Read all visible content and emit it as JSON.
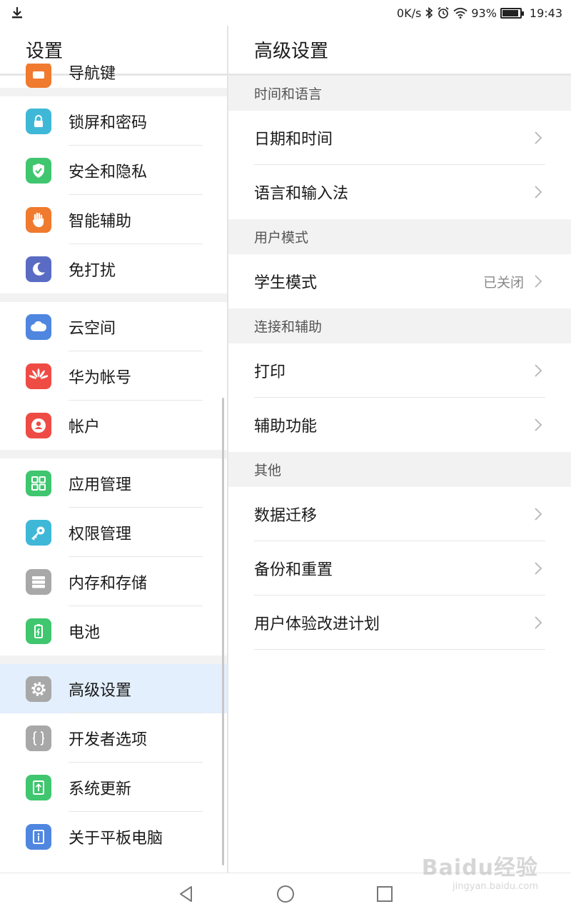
{
  "status_bar": {
    "net_speed": "0K/s",
    "battery_percent": "93%",
    "battery_level": 0.93,
    "time": "19:43"
  },
  "left_pane": {
    "title": "设置",
    "partial_item": {
      "label": "导航键",
      "icon": "nav-key-icon",
      "color": "#f07a2e"
    },
    "groups": [
      [
        {
          "label": "锁屏和密码",
          "icon": "lock-icon",
          "color": "#3fb8d8"
        },
        {
          "label": "安全和隐私",
          "icon": "shield-check-icon",
          "color": "#3fc66f"
        },
        {
          "label": "智能辅助",
          "icon": "hand-icon",
          "color": "#f07a2e"
        },
        {
          "label": "免打扰",
          "icon": "moon-icon",
          "color": "#5a6bc4"
        }
      ],
      [
        {
          "label": "云空间",
          "icon": "cloud-icon",
          "color": "#4f86e0"
        },
        {
          "label": "华为帐号",
          "icon": "huawei-icon",
          "color": "#ef4b45"
        },
        {
          "label": "帐户",
          "icon": "person-icon",
          "color": "#ef4b45"
        }
      ],
      [
        {
          "label": "应用管理",
          "icon": "apps-grid-icon",
          "color": "#3fc66f"
        },
        {
          "label": "权限管理",
          "icon": "key-icon",
          "color": "#3fb8d8"
        },
        {
          "label": "内存和存储",
          "icon": "storage-icon",
          "color": "#a8a8a8"
        },
        {
          "label": "电池",
          "icon": "battery-icon",
          "color": "#3fc66f"
        }
      ],
      [
        {
          "label": "高级设置",
          "icon": "gear-icon",
          "color": "#a8a8a8",
          "selected": true
        },
        {
          "label": "开发者选项",
          "icon": "braces-icon",
          "color": "#a8a8a8"
        },
        {
          "label": "系统更新",
          "icon": "update-arrow-icon",
          "color": "#3fc66f"
        },
        {
          "label": "关于平板电脑",
          "icon": "info-icon",
          "color": "#4f86e0"
        }
      ]
    ]
  },
  "right_pane": {
    "title": "高级设置",
    "sections": [
      {
        "title": "时间和语言",
        "items": [
          {
            "label": "日期和时间"
          },
          {
            "label": "语言和输入法"
          }
        ]
      },
      {
        "title": "用户模式",
        "items": [
          {
            "label": "学生模式",
            "value": "已关闭"
          }
        ]
      },
      {
        "title": "连接和辅助",
        "items": [
          {
            "label": "打印"
          },
          {
            "label": "辅助功能"
          }
        ]
      },
      {
        "title": "其他",
        "items": [
          {
            "label": "数据迁移"
          },
          {
            "label": "备份和重置"
          },
          {
            "label": "用户体验改进计划"
          }
        ]
      }
    ]
  },
  "watermark": {
    "brand": "Baidu经验",
    "url": "jingyan.baidu.com"
  }
}
